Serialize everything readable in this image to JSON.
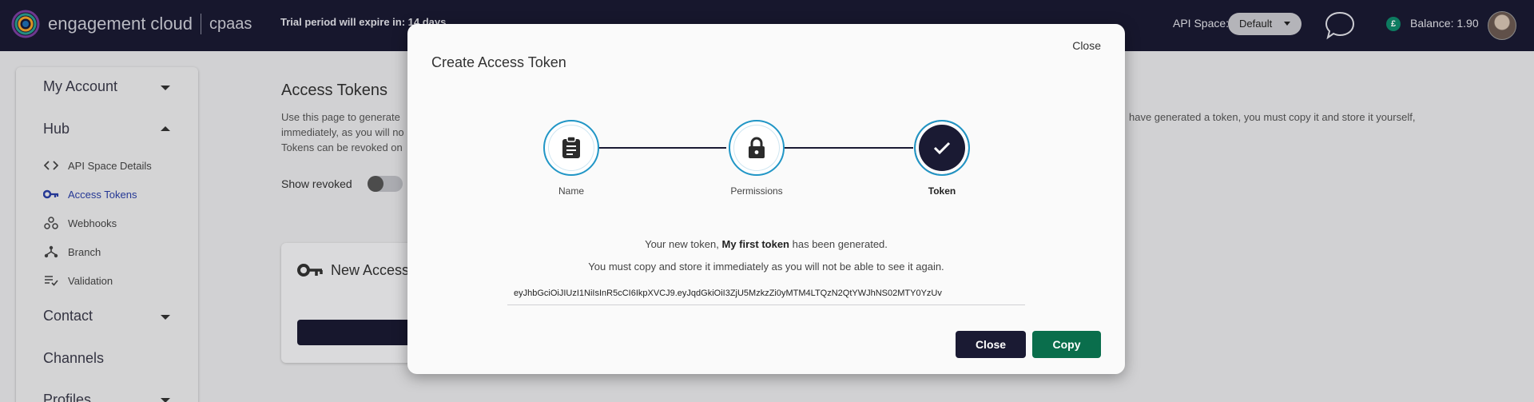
{
  "header": {
    "brand_name": "engagement cloud",
    "brand_sub": "cpaas",
    "trial_text": "Trial period will expire in: 14 days",
    "api_space_label": "API Space:",
    "api_space_value": "Default",
    "balance_symbol": "£",
    "balance_text": "Balance: 1.90"
  },
  "sidebar": {
    "sections": {
      "my_account": "My Account",
      "hub": "Hub",
      "contact": "Contact",
      "channels": "Channels",
      "profiles": "Profiles"
    },
    "hub_items": [
      {
        "label": "API Space Details",
        "icon": "code-icon"
      },
      {
        "label": "Access Tokens",
        "icon": "key-icon"
      },
      {
        "label": "Webhooks",
        "icon": "webhook-icon"
      },
      {
        "label": "Branch",
        "icon": "branch-icon"
      },
      {
        "label": "Validation",
        "icon": "validation-icon"
      }
    ]
  },
  "main": {
    "title": "Access Tokens",
    "desc_line1": "Use this page to generate",
    "desc_line1_right": "have generated a token, you must copy it and store it yourself,",
    "desc_line2": "immediately, as you will no",
    "desc_line3": "Tokens can be revoked on",
    "show_revoked": "Show revoked",
    "card_title": "New Access"
  },
  "modal": {
    "close_link": "Close",
    "title": "Create Access Token",
    "steps": [
      {
        "label": "Name",
        "icon": "clipboard-icon",
        "state": "complete"
      },
      {
        "label": "Permissions",
        "icon": "lock-icon",
        "state": "complete"
      },
      {
        "label": "Token",
        "icon": "check-icon",
        "state": "current"
      }
    ],
    "msg_prefix": "Your new token,",
    "token_name": "My first token",
    "msg_suffix": "has been generated.",
    "msg2": "You must copy and store it immediately as you will not be able to see it again.",
    "token_value": "eyJhbGciOiJIUzI1NiIsInR5cCI6IkpXVCJ9.eyJqdGkiOiI3ZjU5MzkzZi0yMTM4LTQzN2QtYWJhNS02MTY0YzUv",
    "close_button": "Close",
    "copy_button": "Copy"
  },
  "colors": {
    "navy": "#1a1a33",
    "accent_blue": "#2196c6",
    "copy_green": "#0a6e4c",
    "active_link": "#2a3fa6"
  }
}
